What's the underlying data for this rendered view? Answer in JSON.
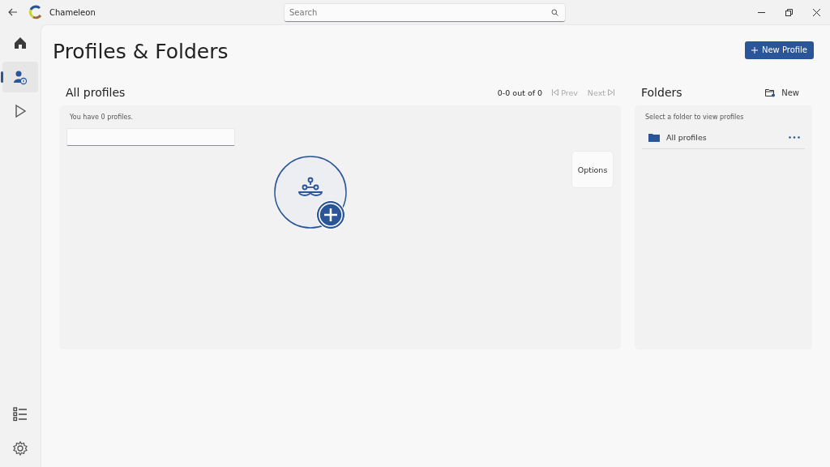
{
  "window": {
    "title": "Chameleon"
  },
  "search": {
    "placeholder": "Search"
  },
  "nav": [
    {
      "kind": "home",
      "selected": false
    },
    {
      "kind": "profiles",
      "selected": true
    },
    {
      "kind": "play",
      "selected": false
    }
  ],
  "nav_bottom": [
    {
      "kind": "list",
      "selected": false
    },
    {
      "kind": "settings",
      "selected": false
    }
  ],
  "page_title": "Profiles & Folders",
  "new_profile_button": "New Profile",
  "profiles": {
    "heading": "All profiles",
    "range": "0-0 out of 0",
    "prev": {
      "label": "Prev",
      "disabled": true
    },
    "next": {
      "label": "Next",
      "disabled": true
    },
    "count_text": "You have 0 profiles.",
    "options_button": "Options"
  },
  "folders": {
    "heading": "Folders",
    "new_button": "New",
    "hint": "Select a folder to view profiles",
    "items": [
      {
        "name": "All profiles",
        "selected": false
      }
    ]
  }
}
